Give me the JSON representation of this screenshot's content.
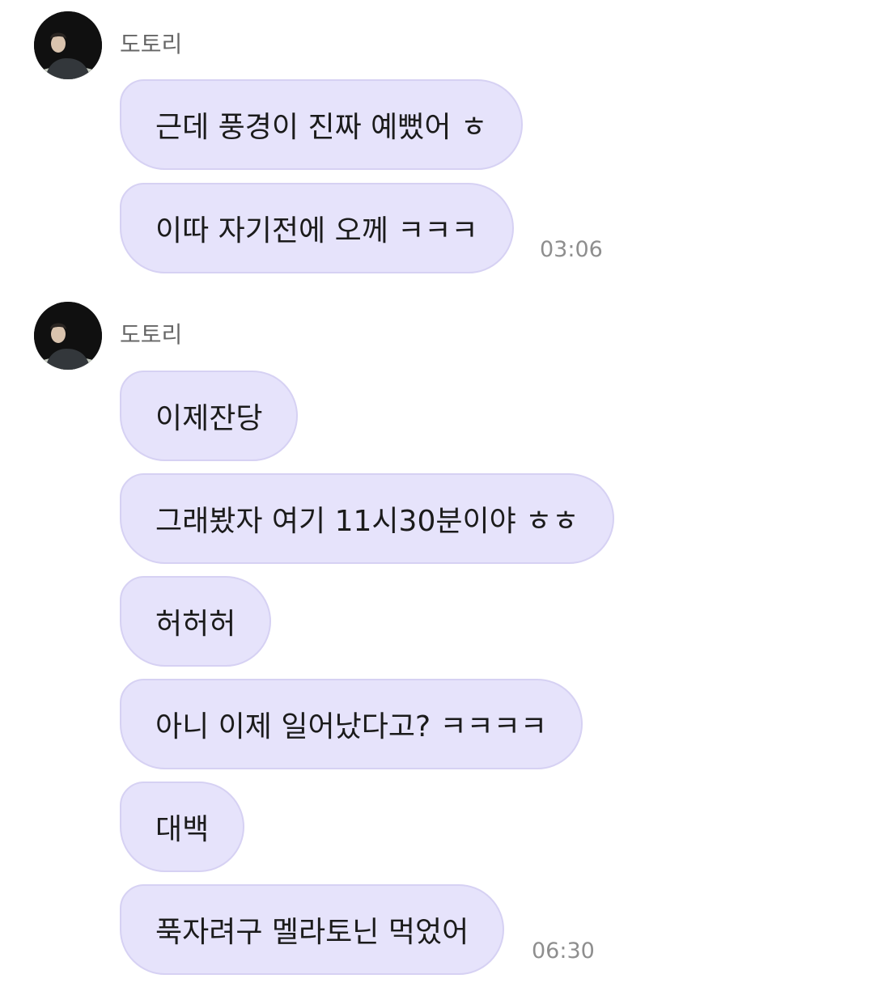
{
  "colors": {
    "bubble": "#e6e3fb",
    "bubble_border": "#d6d1f3",
    "sender": "#666666",
    "timestamp": "#8e8e8e"
  },
  "groups": [
    {
      "sender": "도토리",
      "avatar": "profile-photo",
      "messages": [
        {
          "text": "근데 풍경이 진짜 예뻤어 ㅎ"
        },
        {
          "text": "이따 자기전에 오께 ㅋㅋㅋ"
        }
      ],
      "time": "03:06"
    },
    {
      "sender": "도토리",
      "avatar": "profile-photo",
      "messages": [
        {
          "text": "이제잔당"
        },
        {
          "text": "그래봤자 여기 11시30분이야 ㅎㅎ"
        },
        {
          "text": "허허허"
        },
        {
          "text": "아니 이제 일어났다고? ㅋㅋㅋㅋ"
        },
        {
          "text": "대백"
        },
        {
          "text": "푹자려구 멜라토닌 먹었어"
        }
      ],
      "time": "06:30"
    }
  ]
}
